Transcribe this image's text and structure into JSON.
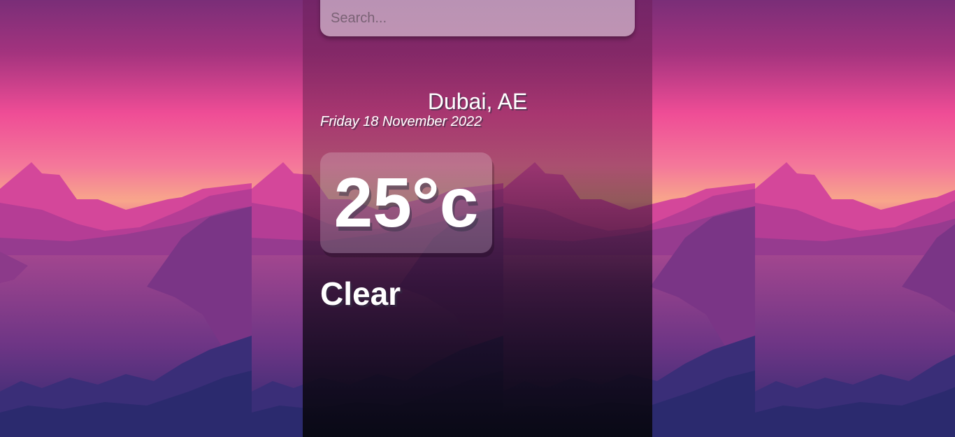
{
  "search": {
    "placeholder": "Search...",
    "value": ""
  },
  "location": {
    "city_country": "Dubai, AE",
    "date": "Friday 18 November 2022"
  },
  "weather": {
    "temperature": "25°c",
    "condition": "Clear"
  },
  "colors": {
    "sky_top": "#7a2e78",
    "sky_glow": "#ef4d96",
    "horizon": "#f7a08c",
    "mountain": "#d4479a",
    "water_deep": "#2a2a6e"
  }
}
